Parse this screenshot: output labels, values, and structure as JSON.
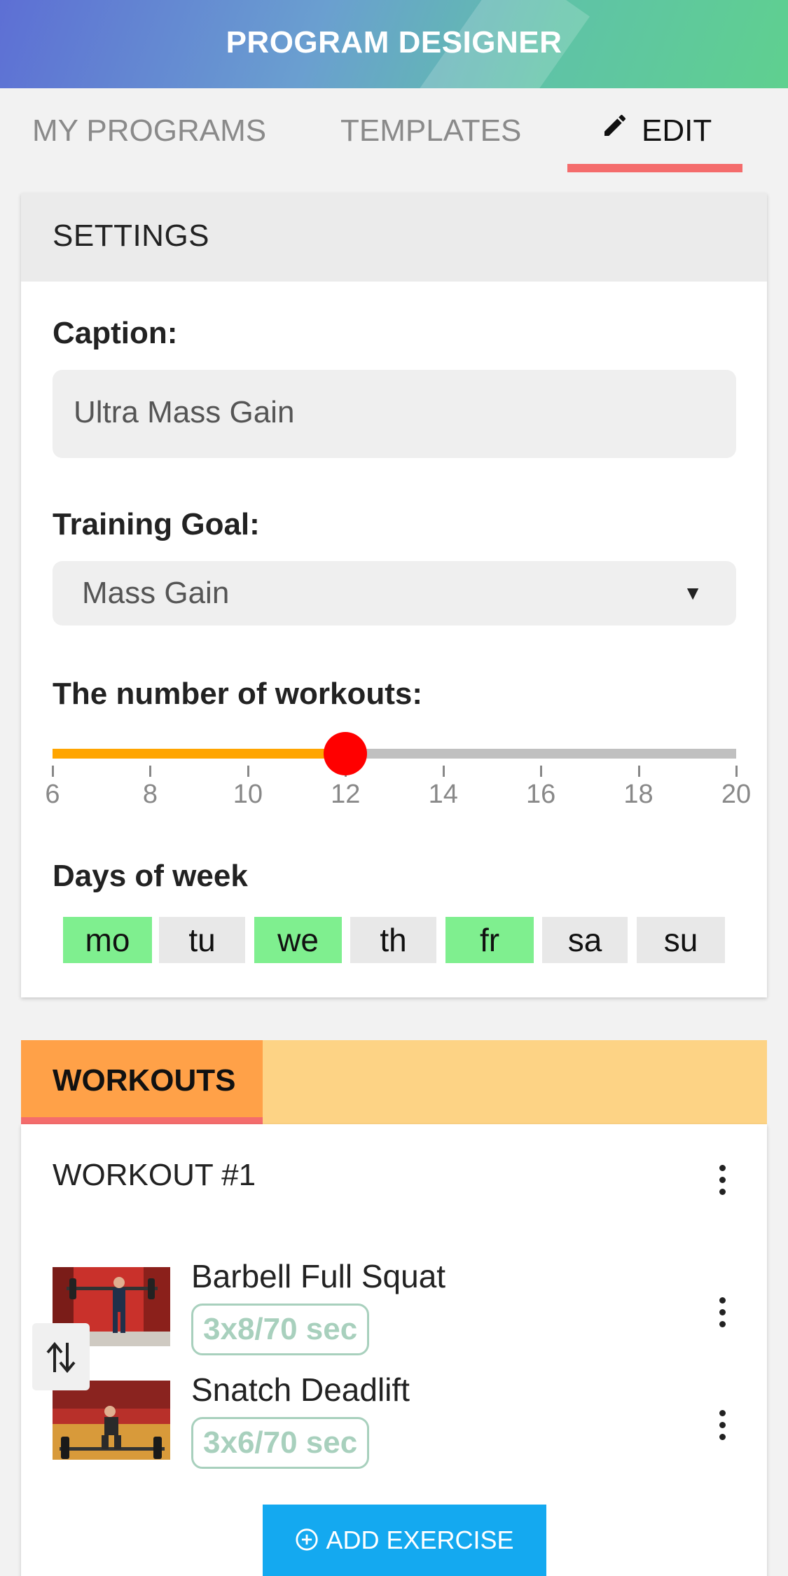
{
  "header": {
    "title": "PROGRAM DESIGNER"
  },
  "tabs": [
    {
      "label": "MY PROGRAMS",
      "active": false
    },
    {
      "label": "TEMPLATES",
      "active": false
    },
    {
      "label": "EDIT",
      "active": true,
      "icon": "pencil-icon"
    }
  ],
  "settings": {
    "title": "SETTINGS",
    "caption_label": "Caption:",
    "caption_value": "Ultra Mass Gain",
    "goal_label": "Training Goal:",
    "goal_value": "Mass Gain",
    "workouts_label": "The number of workouts:",
    "workouts_slider": {
      "min": 6,
      "max": 20,
      "value": 12,
      "ticks": [
        "6",
        "8",
        "10",
        "12",
        "14",
        "16",
        "18",
        "20"
      ]
    },
    "days_label": "Days of week",
    "days": [
      {
        "label": "mo",
        "selected": true
      },
      {
        "label": "tu",
        "selected": false
      },
      {
        "label": "we",
        "selected": true
      },
      {
        "label": "th",
        "selected": false
      },
      {
        "label": "fr",
        "selected": true
      },
      {
        "label": "sa",
        "selected": false
      },
      {
        "label": "su",
        "selected": false
      }
    ]
  },
  "workouts": {
    "tab_label": "WORKOUTS",
    "workout_title": "WORKOUT #1",
    "exercises": [
      {
        "name": "Barbell Full Squat",
        "scheme": "3x8/70 sec"
      },
      {
        "name": "Snatch Deadlift",
        "scheme": "3x6/70 sec"
      }
    ],
    "add_button": "ADD EXERCISE"
  },
  "colors": {
    "accent_underline": "#f46c6c",
    "slider_fill": "#ffa500",
    "slider_thumb": "#ff0000",
    "day_selected": "#7fef8f",
    "workouts_tab": "#ffa148",
    "workouts_bar": "#fdd385",
    "add_button": "#14a9f0",
    "badge": "#a8d0bd"
  }
}
